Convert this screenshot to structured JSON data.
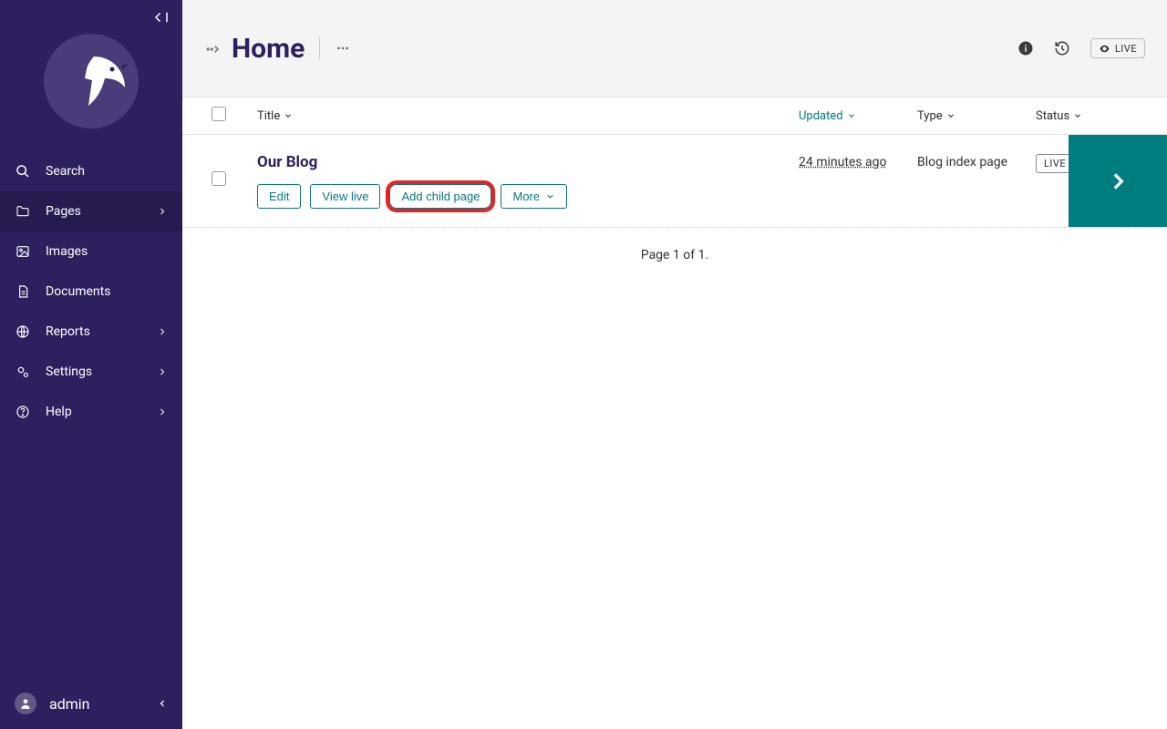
{
  "sidebar": {
    "items": [
      {
        "label": "Search",
        "active": false,
        "has_sub": false
      },
      {
        "label": "Pages",
        "active": true,
        "has_sub": true
      },
      {
        "label": "Images",
        "active": false,
        "has_sub": false
      },
      {
        "label": "Documents",
        "active": false,
        "has_sub": false
      },
      {
        "label": "Reports",
        "active": false,
        "has_sub": true
      },
      {
        "label": "Settings",
        "active": false,
        "has_sub": true
      },
      {
        "label": "Help",
        "active": false,
        "has_sub": true
      }
    ],
    "user": "admin"
  },
  "header": {
    "title": "Home",
    "live_badge": "LIVE"
  },
  "columns": {
    "title": "Title",
    "updated": "Updated",
    "type": "Type",
    "status": "Status"
  },
  "rows": [
    {
      "title": "Our Blog",
      "updated": "24 minutes ago",
      "type": "Blog index page",
      "status": "LIVE",
      "actions": {
        "edit": "Edit",
        "view_live": "View live",
        "add_child": "Add child page",
        "more": "More"
      }
    }
  ],
  "pager": "Page 1 of 1."
}
